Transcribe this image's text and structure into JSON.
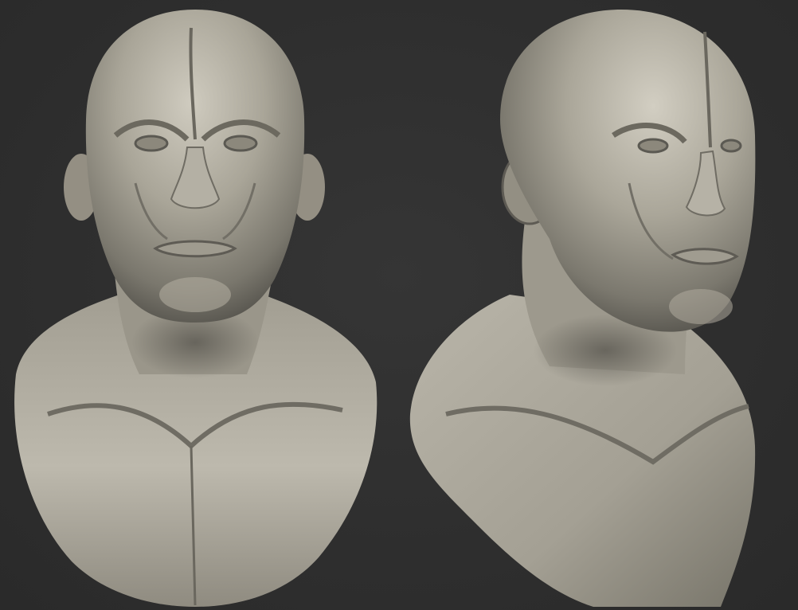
{
  "scene": {
    "background_color": "#2f2f2f",
    "material_light": "#c6c2b6",
    "material_mid": "#918d82",
    "material_dark": "#4a4842",
    "views": [
      {
        "name": "front-view",
        "subject": "sculpted-bust"
      },
      {
        "name": "three-quarter-view",
        "subject": "sculpted-bust"
      }
    ]
  }
}
